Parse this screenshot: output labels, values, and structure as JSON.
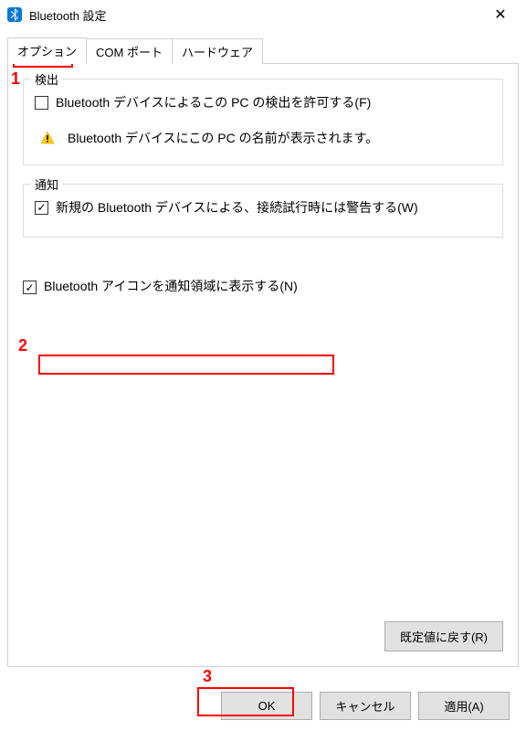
{
  "titlebar": {
    "title": "Bluetooth 設定"
  },
  "tabs": {
    "options": "オプション",
    "com_ports": "COM ポート",
    "hardware": "ハードウェア"
  },
  "detection": {
    "title": "検出",
    "allow_discover": "Bluetooth デバイスによるこの PC の検出を許可する(F)",
    "info": "Bluetooth デバイスにこの PC の名前が表示されます。"
  },
  "notifications": {
    "title": "通知",
    "warn_new": "新規の Bluetooth デバイスによる、接続試行時には警告する(W)"
  },
  "tray_icon": {
    "label": "Bluetooth アイコンを通知領域に表示する(N)"
  },
  "buttons": {
    "defaults": "既定値に戻す(R)",
    "ok": "OK",
    "cancel": "キャンセル",
    "apply": "適用(A)"
  },
  "annotations": {
    "n1": "1",
    "n2": "2",
    "n3": "3"
  }
}
